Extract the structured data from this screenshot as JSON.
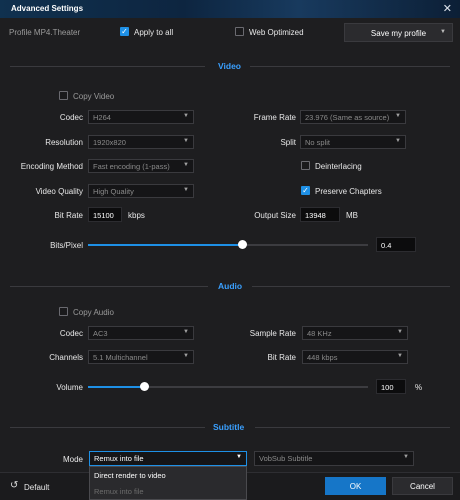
{
  "window": {
    "title": "Advanced Settings",
    "close_glyph": "✕"
  },
  "header": {
    "profile_label": "Profile",
    "profile_name": "MP4.Theater",
    "apply_all_label": "Apply to all",
    "apply_all_checked": true,
    "web_optimized_label": "Web Optimized",
    "web_optimized_checked": false,
    "save_profile_label": "Save my profile"
  },
  "video": {
    "section_title": "Video",
    "copy_video_label": "Copy Video",
    "codec_label": "Codec",
    "codec_value": "H264",
    "frame_rate_label": "Frame Rate",
    "frame_rate_value": "23.976 (Same as source)",
    "resolution_label": "Resolution",
    "resolution_value": "1920x820",
    "split_label": "Split",
    "split_value": "No split",
    "encoding_label": "Encoding Method",
    "encoding_value": "Fast encoding (1-pass)",
    "deinterlacing_label": "Deinterlacing",
    "quality_label": "Video Quality",
    "quality_value": "High Quality",
    "preserve_chapters_label": "Preserve Chapters",
    "bit_rate_label": "Bit Rate",
    "bit_rate_value": "15100",
    "bit_rate_unit": "kbps",
    "output_size_label": "Output Size",
    "output_size_value": "13948",
    "output_size_unit": "MB",
    "bits_pixel_label": "Bits/Pixel",
    "bits_pixel_value": "0.4",
    "bits_pixel_fraction": 0.55
  },
  "audio": {
    "section_title": "Audio",
    "copy_audio_label": "Copy Audio",
    "codec_label": "Codec",
    "codec_value": "AC3",
    "sample_rate_label": "Sample Rate",
    "sample_rate_value": "48 KHz",
    "channels_label": "Channels",
    "channels_value": "5.1 Multichannel",
    "bit_rate_label": "Bit Rate",
    "bit_rate_value": "448 kbps",
    "volume_label": "Volume",
    "volume_value": "100",
    "volume_unit": "%",
    "volume_fraction": 0.2
  },
  "subtitle": {
    "section_title": "Subtitle",
    "mode_label": "Mode",
    "mode_value": "Remux into file",
    "mode_options": [
      "Direct render to video",
      "Remux into file"
    ],
    "vobsub_value": "VobSub Subtitle"
  },
  "footer": {
    "default_label": "Default",
    "ok_label": "OK",
    "cancel_label": "Cancel"
  },
  "colors": {
    "accent": "#1e90e6",
    "section": "#3aa0ff",
    "background": "#1e1e20"
  },
  "icons": {
    "close": "close-icon",
    "chevron": "chevron-down-icon",
    "reset": "reset-icon",
    "check": "checkmark-icon"
  }
}
